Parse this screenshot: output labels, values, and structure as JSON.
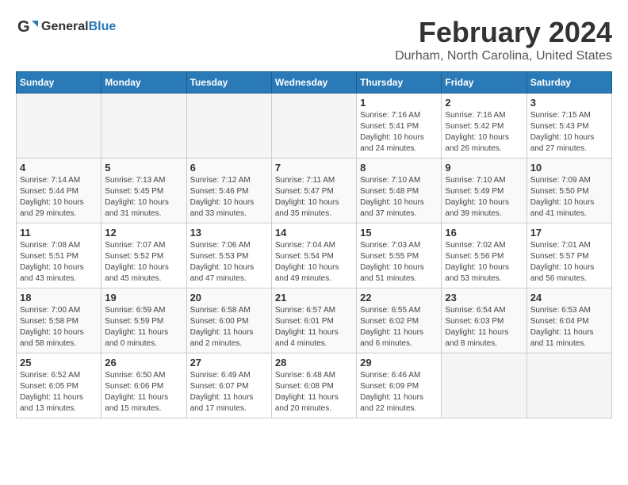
{
  "logo": {
    "text_general": "General",
    "text_blue": "Blue"
  },
  "header": {
    "month": "February 2024",
    "location": "Durham, North Carolina, United States"
  },
  "weekdays": [
    "Sunday",
    "Monday",
    "Tuesday",
    "Wednesday",
    "Thursday",
    "Friday",
    "Saturday"
  ],
  "weeks": [
    [
      {
        "day": "",
        "info": ""
      },
      {
        "day": "",
        "info": ""
      },
      {
        "day": "",
        "info": ""
      },
      {
        "day": "",
        "info": ""
      },
      {
        "day": "1",
        "info": "Sunrise: 7:16 AM\nSunset: 5:41 PM\nDaylight: 10 hours and 24 minutes."
      },
      {
        "day": "2",
        "info": "Sunrise: 7:16 AM\nSunset: 5:42 PM\nDaylight: 10 hours and 26 minutes."
      },
      {
        "day": "3",
        "info": "Sunrise: 7:15 AM\nSunset: 5:43 PM\nDaylight: 10 hours and 27 minutes."
      }
    ],
    [
      {
        "day": "4",
        "info": "Sunrise: 7:14 AM\nSunset: 5:44 PM\nDaylight: 10 hours and 29 minutes."
      },
      {
        "day": "5",
        "info": "Sunrise: 7:13 AM\nSunset: 5:45 PM\nDaylight: 10 hours and 31 minutes."
      },
      {
        "day": "6",
        "info": "Sunrise: 7:12 AM\nSunset: 5:46 PM\nDaylight: 10 hours and 33 minutes."
      },
      {
        "day": "7",
        "info": "Sunrise: 7:11 AM\nSunset: 5:47 PM\nDaylight: 10 hours and 35 minutes."
      },
      {
        "day": "8",
        "info": "Sunrise: 7:10 AM\nSunset: 5:48 PM\nDaylight: 10 hours and 37 minutes."
      },
      {
        "day": "9",
        "info": "Sunrise: 7:10 AM\nSunset: 5:49 PM\nDaylight: 10 hours and 39 minutes."
      },
      {
        "day": "10",
        "info": "Sunrise: 7:09 AM\nSunset: 5:50 PM\nDaylight: 10 hours and 41 minutes."
      }
    ],
    [
      {
        "day": "11",
        "info": "Sunrise: 7:08 AM\nSunset: 5:51 PM\nDaylight: 10 hours and 43 minutes."
      },
      {
        "day": "12",
        "info": "Sunrise: 7:07 AM\nSunset: 5:52 PM\nDaylight: 10 hours and 45 minutes."
      },
      {
        "day": "13",
        "info": "Sunrise: 7:06 AM\nSunset: 5:53 PM\nDaylight: 10 hours and 47 minutes."
      },
      {
        "day": "14",
        "info": "Sunrise: 7:04 AM\nSunset: 5:54 PM\nDaylight: 10 hours and 49 minutes."
      },
      {
        "day": "15",
        "info": "Sunrise: 7:03 AM\nSunset: 5:55 PM\nDaylight: 10 hours and 51 minutes."
      },
      {
        "day": "16",
        "info": "Sunrise: 7:02 AM\nSunset: 5:56 PM\nDaylight: 10 hours and 53 minutes."
      },
      {
        "day": "17",
        "info": "Sunrise: 7:01 AM\nSunset: 5:57 PM\nDaylight: 10 hours and 56 minutes."
      }
    ],
    [
      {
        "day": "18",
        "info": "Sunrise: 7:00 AM\nSunset: 5:58 PM\nDaylight: 10 hours and 58 minutes."
      },
      {
        "day": "19",
        "info": "Sunrise: 6:59 AM\nSunset: 5:59 PM\nDaylight: 11 hours and 0 minutes."
      },
      {
        "day": "20",
        "info": "Sunrise: 6:58 AM\nSunset: 6:00 PM\nDaylight: 11 hours and 2 minutes."
      },
      {
        "day": "21",
        "info": "Sunrise: 6:57 AM\nSunset: 6:01 PM\nDaylight: 11 hours and 4 minutes."
      },
      {
        "day": "22",
        "info": "Sunrise: 6:55 AM\nSunset: 6:02 PM\nDaylight: 11 hours and 6 minutes."
      },
      {
        "day": "23",
        "info": "Sunrise: 6:54 AM\nSunset: 6:03 PM\nDaylight: 11 hours and 8 minutes."
      },
      {
        "day": "24",
        "info": "Sunrise: 6:53 AM\nSunset: 6:04 PM\nDaylight: 11 hours and 11 minutes."
      }
    ],
    [
      {
        "day": "25",
        "info": "Sunrise: 6:52 AM\nSunset: 6:05 PM\nDaylight: 11 hours and 13 minutes."
      },
      {
        "day": "26",
        "info": "Sunrise: 6:50 AM\nSunset: 6:06 PM\nDaylight: 11 hours and 15 minutes."
      },
      {
        "day": "27",
        "info": "Sunrise: 6:49 AM\nSunset: 6:07 PM\nDaylight: 11 hours and 17 minutes."
      },
      {
        "day": "28",
        "info": "Sunrise: 6:48 AM\nSunset: 6:08 PM\nDaylight: 11 hours and 20 minutes."
      },
      {
        "day": "29",
        "info": "Sunrise: 6:46 AM\nSunset: 6:09 PM\nDaylight: 11 hours and 22 minutes."
      },
      {
        "day": "",
        "info": ""
      },
      {
        "day": "",
        "info": ""
      }
    ]
  ]
}
